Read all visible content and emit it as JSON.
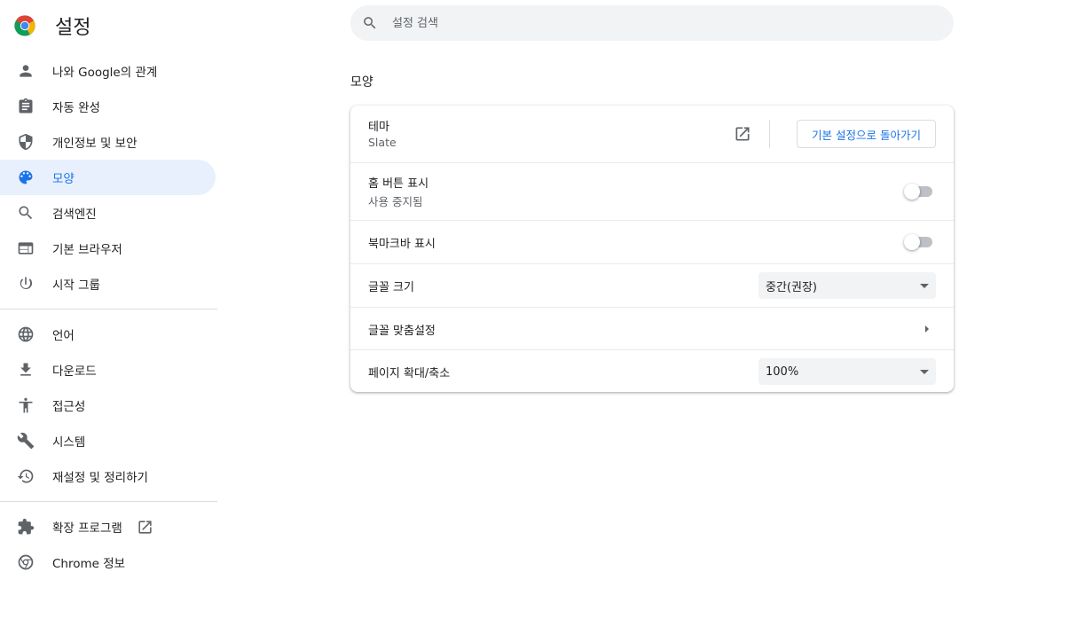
{
  "header": {
    "title": "설정"
  },
  "search": {
    "placeholder": "설정 검색"
  },
  "sidebar": {
    "group1": [
      {
        "label": "나와 Google의 관계",
        "icon": "person-icon"
      },
      {
        "label": "자동 완성",
        "icon": "clipboard-icon"
      },
      {
        "label": "개인정보 및 보안",
        "icon": "shield-icon"
      },
      {
        "label": "모양",
        "icon": "palette-icon",
        "active": true
      },
      {
        "label": "검색엔진",
        "icon": "search-icon"
      },
      {
        "label": "기본 브라우저",
        "icon": "browser-icon"
      },
      {
        "label": "시작 그룹",
        "icon": "power-icon"
      }
    ],
    "group2": [
      {
        "label": "언어",
        "icon": "globe-icon"
      },
      {
        "label": "다운로드",
        "icon": "download-icon"
      },
      {
        "label": "접근성",
        "icon": "accessibility-icon"
      },
      {
        "label": "시스템",
        "icon": "wrench-icon"
      },
      {
        "label": "재설정 및 정리하기",
        "icon": "history-icon"
      }
    ],
    "group3": [
      {
        "label": "확장 프로그램",
        "icon": "puzzle-icon"
      },
      {
        "label": "Chrome 정보",
        "icon": "chrome-icon"
      }
    ]
  },
  "appearance": {
    "section_title": "모양",
    "theme": {
      "label": "테마",
      "value": "Slate",
      "reset_button": "기본 설정으로 돌아가기"
    },
    "home_button": {
      "label": "홈 버튼 표시",
      "sub": "사용 중지됨",
      "enabled": false
    },
    "bookmarks_bar": {
      "label": "북마크바 표시",
      "enabled": false
    },
    "font_size": {
      "label": "글꼴 크기",
      "value": "중간(권장)"
    },
    "customize_fonts": {
      "label": "글꼴 맞춤설정"
    },
    "page_zoom": {
      "label": "페이지 확대/축소",
      "value": "100%"
    }
  },
  "colors": {
    "accent": "#1a73e8",
    "active_bg": "#e8f0fe",
    "icon_gray": "#5f6368"
  }
}
